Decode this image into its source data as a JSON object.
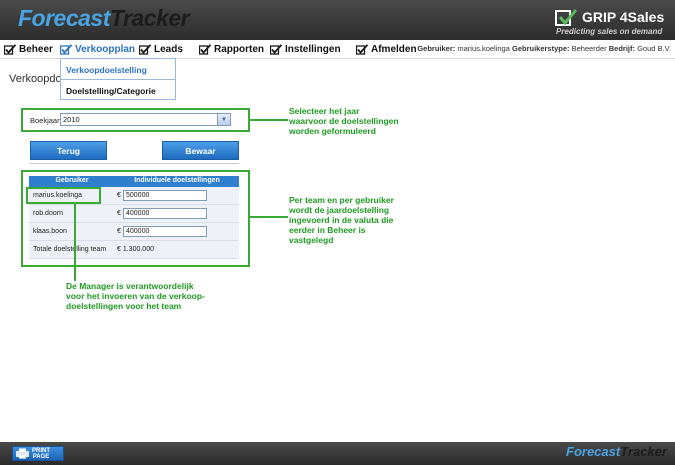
{
  "header": {
    "logo_part1": "Forecast",
    "logo_part2": "Tracker",
    "brand_name": "GRIP 4Sales",
    "brand_tagline": "Predicting sales on demand"
  },
  "nav": {
    "items": [
      {
        "label": "Beheer",
        "icon": "check-arrow-icon"
      },
      {
        "label": "Verkoopplan",
        "icon": "check-arrow-icon",
        "active": true
      },
      {
        "label": "Leads",
        "icon": "check-arrow-icon"
      },
      {
        "label": "Rapporten",
        "icon": "check-arrow-icon"
      },
      {
        "label": "Instellingen",
        "icon": "check-arrow-icon"
      },
      {
        "label": "Afmelden",
        "icon": "check-arrow-icon"
      }
    ],
    "user": {
      "gebruiker_label": "Gebruiker:",
      "gebruiker_value": "marius.koelinga",
      "type_label": "Gebruikerstype:",
      "type_value": "Beheerder",
      "bedrijf_label": "Bedrijf:",
      "bedrijf_value": "Goud B.V."
    }
  },
  "dropdown": {
    "item1": "Verkoopdoelstelling",
    "item2": "Doelstelling/Categorie"
  },
  "page_title": "Verkoopdoe",
  "form": {
    "boekjaar_label": "Boekjaar",
    "boekjaar_value": "2010",
    "terug_label": "Terug",
    "bewaar_label": "Bewaar"
  },
  "table": {
    "col1": "Gebruiker",
    "col2": "Individuele doelstellingen",
    "currency": "€",
    "rows": [
      {
        "name": "marius.koelinga",
        "value": "500000"
      },
      {
        "name": "rob.doorn",
        "value": "400000"
      },
      {
        "name": "klaas.boon",
        "value": "400000"
      }
    ],
    "total_label": "Totale doelstelling team",
    "total_value": "€ 1.300.000"
  },
  "callouts": {
    "c1": [
      "Selecteer het jaar",
      "waarvoor de doelstellingen",
      "worden geformuleerd"
    ],
    "c2": [
      "Per team en per gebruiker",
      "wordt de jaardoelstelling",
      "ingevoerd in de valuta die",
      "eerder in Beheer is",
      "vastgelegd"
    ],
    "c3": [
      "De Manager is verantwoordelijk",
      "voor het invoeren van de verkoop-",
      "doelstellingen voor het team"
    ]
  },
  "footer": {
    "print_line1": "PRINT",
    "print_line2": "PAGE",
    "logo_part1": "Forecast",
    "logo_part2": "Tracker"
  },
  "colors": {
    "accent_blue": "#2b73c2",
    "callout_green": "#3aaa35",
    "header_dark": "#2c2c2c"
  }
}
